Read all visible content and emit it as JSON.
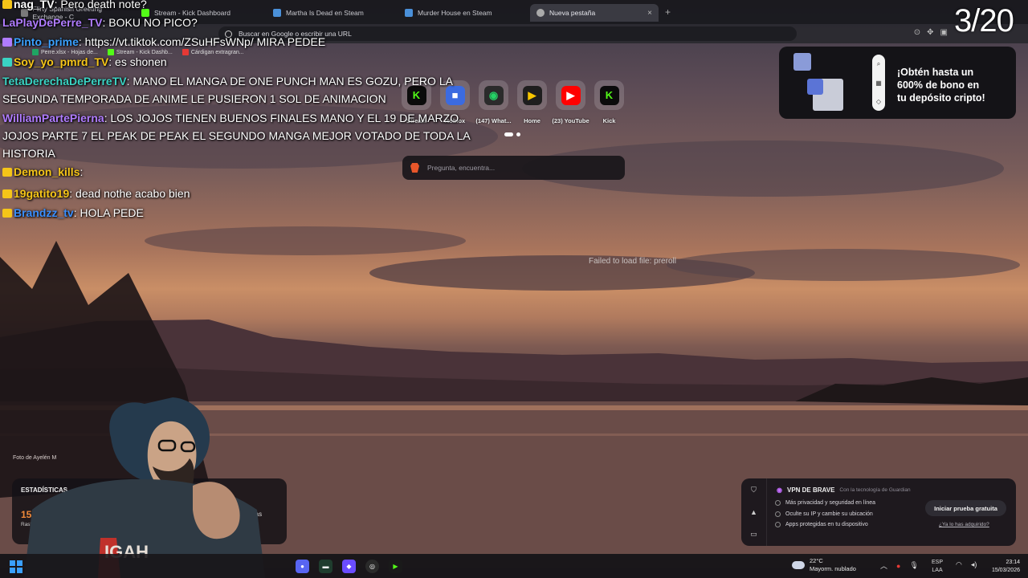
{
  "browser": {
    "tabs": [
      {
        "label": "Flirty Spanish Greeting Exchange - C",
        "color": "#7a7a7a"
      },
      {
        "label": "Stream - Kick Dashboard",
        "color": "#53fc18"
      },
      {
        "label": "Martha Is Dead en Steam",
        "color": "#4a90d9"
      },
      {
        "label": "Murder House en Steam",
        "color": "#4a90d9"
      },
      {
        "label": "Nueva pestaña",
        "color": "#aaaaaa"
      }
    ],
    "active_tab_close": "×",
    "new_tab": "+",
    "address_placeholder": "Buscar en Google o escribir una URL",
    "bookmarks": [
      {
        "label": "Perre.xlsx - Hojas de...",
        "color": "#1fa463"
      },
      {
        "label": "Stream - Kick Dashb...",
        "color": "#53fc18"
      },
      {
        "label": "Cárdigan extragran...",
        "color": "#e53935"
      }
    ]
  },
  "chat": [
    {
      "user": "nag_TV",
      "user_color": "#ffffff",
      "text": ": Pero death note?",
      "badge": "#f5c518"
    },
    {
      "user": "LaPlayDePerre_TV",
      "user_color": "#b07cff",
      "text": ": BOKU NO PICO?",
      "badge": ""
    },
    {
      "user": "Pinto_prime",
      "user_color": "#3aa0ff",
      "text": ": https://vt.tiktok.com/ZSuHFsWNp/ MIRA PEDEE",
      "badge": "#b07cff"
    },
    {
      "user": "Soy_yo_pmrd_TV",
      "user_color": "#f5c518",
      "text": ": es shonen",
      "badge": "#3ad4c4"
    },
    {
      "user": "TetaDerechaDePerreTV",
      "user_color": "#3ad4c4",
      "text": ": MANO EL MANGA DE ONE PUNCH MAN ES GOZU, PERO LA SEGUNDA TEMPORADA DE ANIME LE PUSIERON 1 SOL DE ANIMACION",
      "badge": ""
    },
    {
      "user": "WilliamPartePierna",
      "user_color": "#b07cff",
      "text": ": LOS JOJOS TIENEN BUENOS FINALES MANO Y EL 19 DE MARZO JOJOS PARTE 7 EL PEAK DE PEAK EL SEGUNDO MANGA MEJOR VOTADO DE TODA LA HISTORIA",
      "badge": ""
    },
    {
      "user": "Demon_kills",
      "user_color": "#f5c518",
      "text": ":",
      "badge": "#f5c518"
    },
    {
      "user": "19gatito19",
      "user_color": "#f5c518",
      "text": ": dead nothe acabo bien",
      "badge": "#f5c518"
    },
    {
      "user": "Brandzz_tv",
      "user_color": "#3a8fff",
      "text": ": HOLA PEDE",
      "badge": "#f5c518"
    }
  ],
  "speed_dials": [
    {
      "label": "Stream",
      "bg": "#0b0b0b",
      "glyph": "K",
      "glyph_color": "#53fc18"
    },
    {
      "label": "Roblox",
      "bg": "#3b6be0",
      "glyph": "■",
      "glyph_color": "#ffffff"
    },
    {
      "label": "(147) What...",
      "bg": "#2b2b2b",
      "glyph": "◉",
      "glyph_color": "#25d366"
    },
    {
      "label": "Home",
      "bg": "#1e1e1e",
      "glyph": "▶",
      "glyph_color": "#f7c600"
    },
    {
      "label": "(23) YouTube",
      "bg": "#ff0000",
      "glyph": "▶",
      "glyph_color": "#ffffff"
    },
    {
      "label": "Kick",
      "bg": "#0b0b0b",
      "glyph": "K",
      "glyph_color": "#53fc18"
    }
  ],
  "ask_placeholder": "Pregunta, encuentra...",
  "failed_text": "Failed to load file: preroll",
  "promo": {
    "text_line1": "¡Obtén hasta un",
    "text_line2": "600% de bono en",
    "text_line3": "tu depósito cripto!"
  },
  "counter": "3/20",
  "photo_credit": "Foto de Ayelén M",
  "stats": {
    "title": "ESTADÍSTICAS",
    "value": "157,8",
    "sub": "Rastread",
    "right_label": "ras",
    "right_sub": "rado"
  },
  "vpn": {
    "title": "VPN DE BRAVE",
    "subtitle": "Con la tecnología de Guardian",
    "features": [
      "Más privacidad y seguridad en línea",
      "Oculte su IP y cambie su ubicación",
      "Apps protegidas en tu dispositivo"
    ],
    "button": "Iniciar prueba gratuita",
    "link": "¿Ya lo has adquirido?"
  },
  "taskbar": {
    "weather_temp": "22°C",
    "weather_desc": "Mayorm. nublado",
    "lang_line1": "ESP",
    "lang_line2": "LAA",
    "time": "23:14",
    "date": "15/03/2026"
  }
}
